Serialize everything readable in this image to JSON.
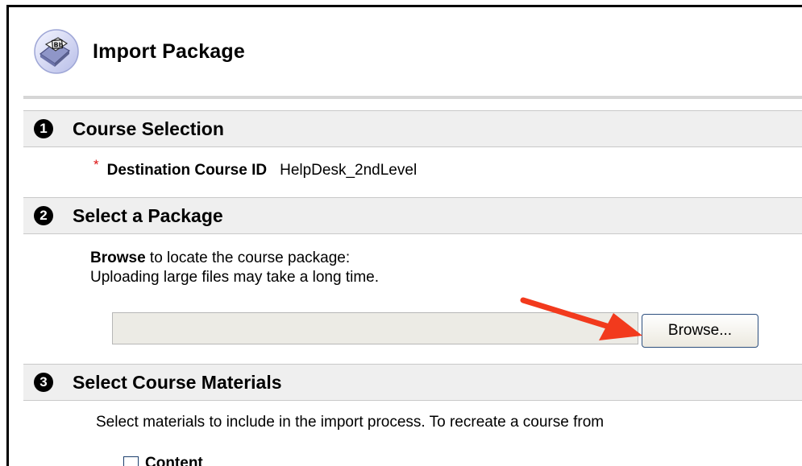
{
  "page": {
    "title": "Import Package",
    "icon": "package-import-icon"
  },
  "sections": [
    {
      "number": "1",
      "title": "Course Selection"
    },
    {
      "number": "2",
      "title": "Select a Package"
    },
    {
      "number": "3",
      "title": "Select Course Materials"
    }
  ],
  "course_selection": {
    "required_mark": "*",
    "label": "Destination Course ID",
    "value": "HelpDesk_2ndLevel"
  },
  "package": {
    "instruction_bold": "Browse",
    "instruction_rest": " to locate the course package:",
    "note": "Uploading large files may take a long time.",
    "file_value": "",
    "browse_label": "Browse..."
  },
  "materials": {
    "description": "Select materials to include in the import process. To recreate a course from",
    "first_item": "Content"
  },
  "colors": {
    "section_bar": "#efefef",
    "required": "#dd1111",
    "annotation_arrow": "#f23a1d",
    "button_border": "#2d4f7e"
  }
}
